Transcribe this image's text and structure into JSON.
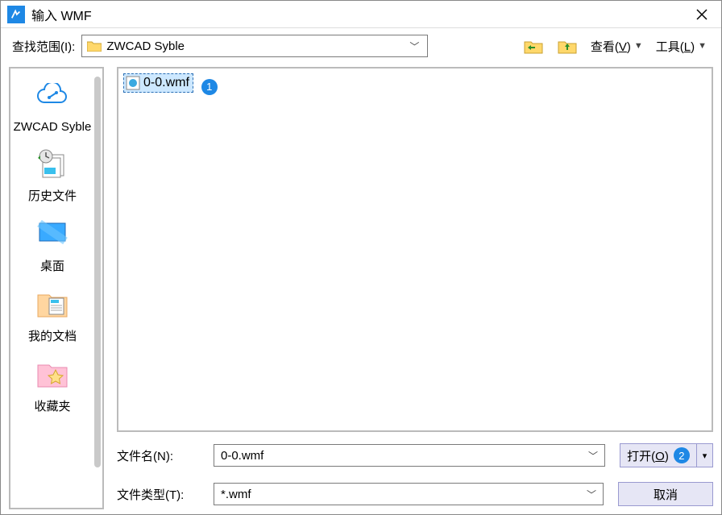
{
  "title": "输入 WMF",
  "toolbar": {
    "lookin_label": "查找范围(I):",
    "location": "ZWCAD Syble",
    "view_label_pre": "查看(",
    "view_label_key": "V",
    "view_label_post": ")",
    "tools_label_pre": "工具(",
    "tools_label_key": "L",
    "tools_label_post": ")"
  },
  "sidebar": {
    "items": [
      {
        "label": "ZWCAD Syble"
      },
      {
        "label": "历史文件"
      },
      {
        "label": "桌面"
      },
      {
        "label": "我的文档"
      },
      {
        "label": "收藏夹"
      }
    ]
  },
  "files": {
    "items": [
      {
        "name": "0-0.wmf",
        "selected": true
      }
    ],
    "badge1": "1"
  },
  "fields": {
    "filename_label": "文件名(N):",
    "filename_value": "0-0.wmf",
    "filetype_label": "文件类型(T):",
    "filetype_value": "*.wmf"
  },
  "buttons": {
    "open_pre": "打开(",
    "open_key": "O",
    "open_post": ")",
    "badge2": "2",
    "open_arrow": "▾",
    "cancel": "取消"
  }
}
